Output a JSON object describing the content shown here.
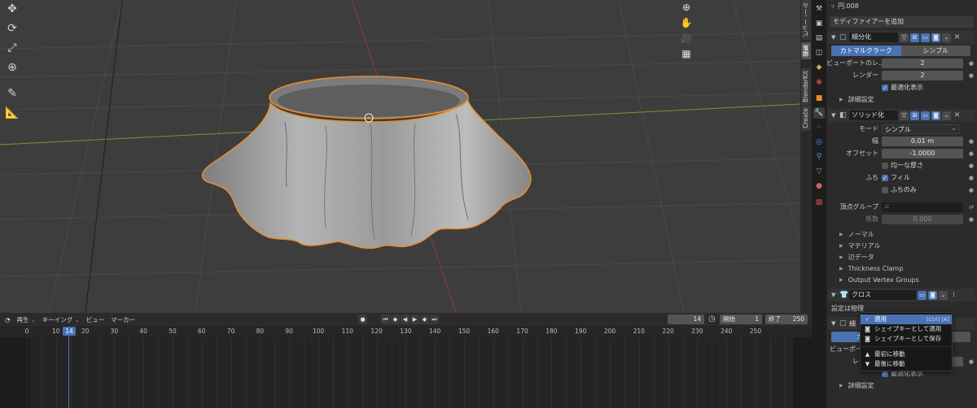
{
  "viewport": {
    "tools": [
      "move-icon",
      "rotate-icon",
      "scale-icon",
      "transform-icon",
      "annotate-icon",
      "measure-icon"
    ],
    "nav": [
      "zoom-icon",
      "hand-icon",
      "camera-icon",
      "grid-icon"
    ]
  },
  "ntabs": [
    "ツール",
    "ビュー",
    "編集",
    "BlenderKit",
    "Create"
  ],
  "object_name": "円.008",
  "add_modifier": "モディファイアーを追加",
  "subdivision": {
    "name": "細分化",
    "mode_a": "カトマルクラーク",
    "mode_b": "シンプル",
    "viewport_label": "ビューポートのレ...",
    "viewport_val": "2",
    "render_label": "レンダー",
    "render_val": "2",
    "optimal_display": "最適化表示",
    "advanced": "詳細設定"
  },
  "solidify": {
    "name": "ソリッド化",
    "mode_label": "モード",
    "mode_val": "シンプル",
    "thickness_label": "幅",
    "thickness_val": "0.01 m",
    "offset_label": "オフセット",
    "offset_val": "-1.0000",
    "even": "均一な厚さ",
    "rim_label": "ふち",
    "fill": "フィル",
    "rim_only": "ふちのみ",
    "vgroup_label": "頂点グループ",
    "factor_label": "係数",
    "factor_val": "0.000",
    "normals": "ノーマル",
    "materials": "マテリアル",
    "edge_data": "辺データ",
    "thickness_clamp": "Thickness Clamp",
    "output_vgroups": "Output Vertex Groups"
  },
  "cloth": {
    "name": "クロス",
    "settings_label": "設定は物理"
  },
  "menu": {
    "apply": "適用",
    "apply_hint": "[Ctrl] [A]",
    "apply_shape": "シェイプキーとして適用",
    "save_shape": "シェイプキーとして保存",
    "move_first": "最初に移動",
    "move_last": "最後に移動"
  },
  "subdivision2": {
    "name_short": "細",
    "mode_a": "カトマ",
    "viewport_label": "ビューポー",
    "render_label": "レンダー",
    "render_val": "2",
    "optimal_display": "最適化表示",
    "advanced": "詳細設定"
  },
  "timeline": {
    "playback": "再生",
    "keying": "キーイング",
    "view": "ビュー",
    "marker": "マーカー",
    "current_frame": "14",
    "start_label": "開始",
    "start_val": "1",
    "end_label": "終了",
    "end_val": "250",
    "ticks": [
      "0",
      "10",
      "14",
      "20",
      "30",
      "40",
      "50",
      "60",
      "70",
      "80",
      "90",
      "100",
      "110",
      "120",
      "130",
      "140",
      "150",
      "160",
      "170",
      "180",
      "190",
      "200",
      "210",
      "220",
      "230",
      "240",
      "250"
    ]
  },
  "colors": {
    "accent": "#4a72b5",
    "selection_outline": "#e8902a",
    "x_axis": "#b23a48",
    "y_axis": "#7aa338"
  }
}
